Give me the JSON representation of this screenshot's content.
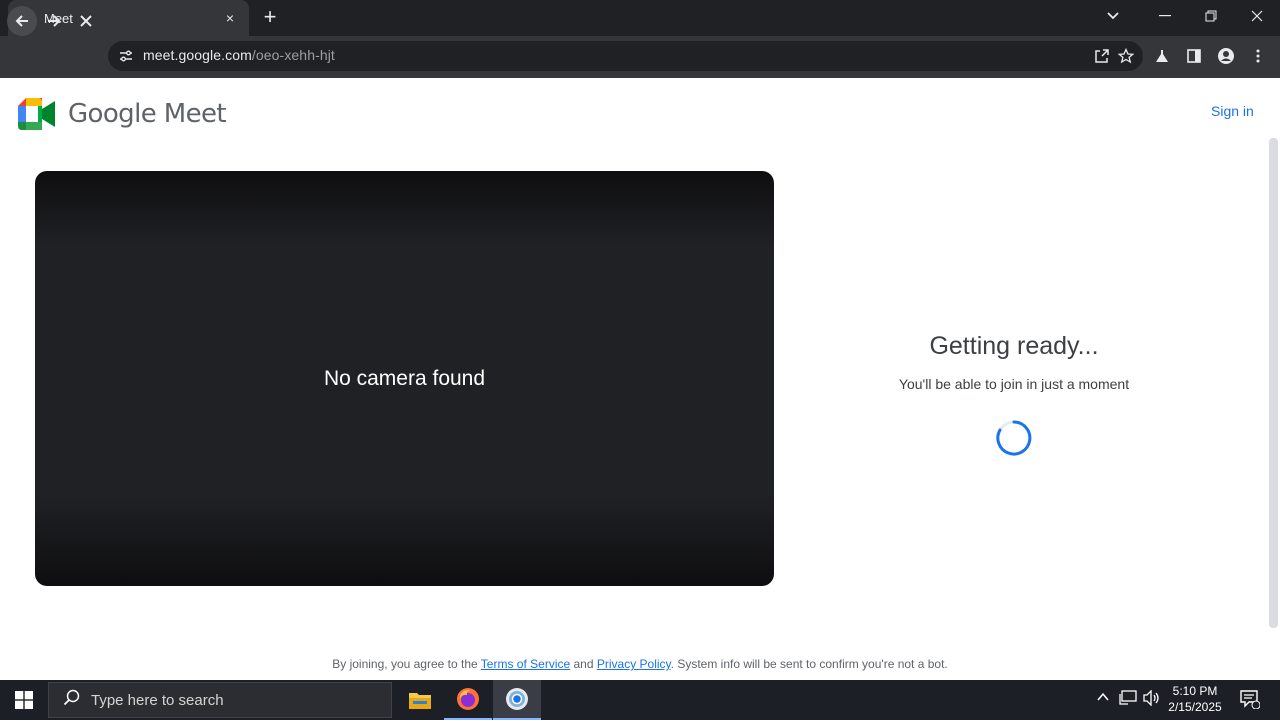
{
  "browser": {
    "tab_title": "Meet",
    "tab_close": "×",
    "new_tab": "+",
    "url_host": "meet.google.com",
    "url_path": "/oeo-xehh-hjt"
  },
  "page": {
    "brand": "Google Meet",
    "sign_in": "Sign in",
    "camera_message": "No camera found",
    "ready_title": "Getting ready...",
    "ready_subtitle": "You'll be able to join in just a moment",
    "legal_prefix": "By joining, you agree to the ",
    "terms_link": "Terms of Service",
    "legal_and": " and ",
    "privacy_link": "Privacy Policy",
    "legal_suffix": ". System info will be sent to confirm you're not a bot."
  },
  "taskbar": {
    "search_placeholder": "Type here to search",
    "time": "5:10 PM",
    "date": "2/15/2025"
  },
  "colors": {
    "accent": "#1a73e8",
    "video_bg": "#202124",
    "chrome_dark": "#202124"
  },
  "icons": [
    "meet-favicon",
    "back-icon",
    "forward-icon",
    "stop-icon",
    "site-info-icon",
    "share-icon",
    "star-icon",
    "labs-icon",
    "side-panel-icon",
    "profile-icon",
    "menu-icon",
    "windows-icon",
    "search-icon",
    "file-explorer-icon",
    "firefox-icon",
    "chrome-icon",
    "chevron-up-icon",
    "network-icon",
    "volume-icon",
    "notification-icon"
  ]
}
